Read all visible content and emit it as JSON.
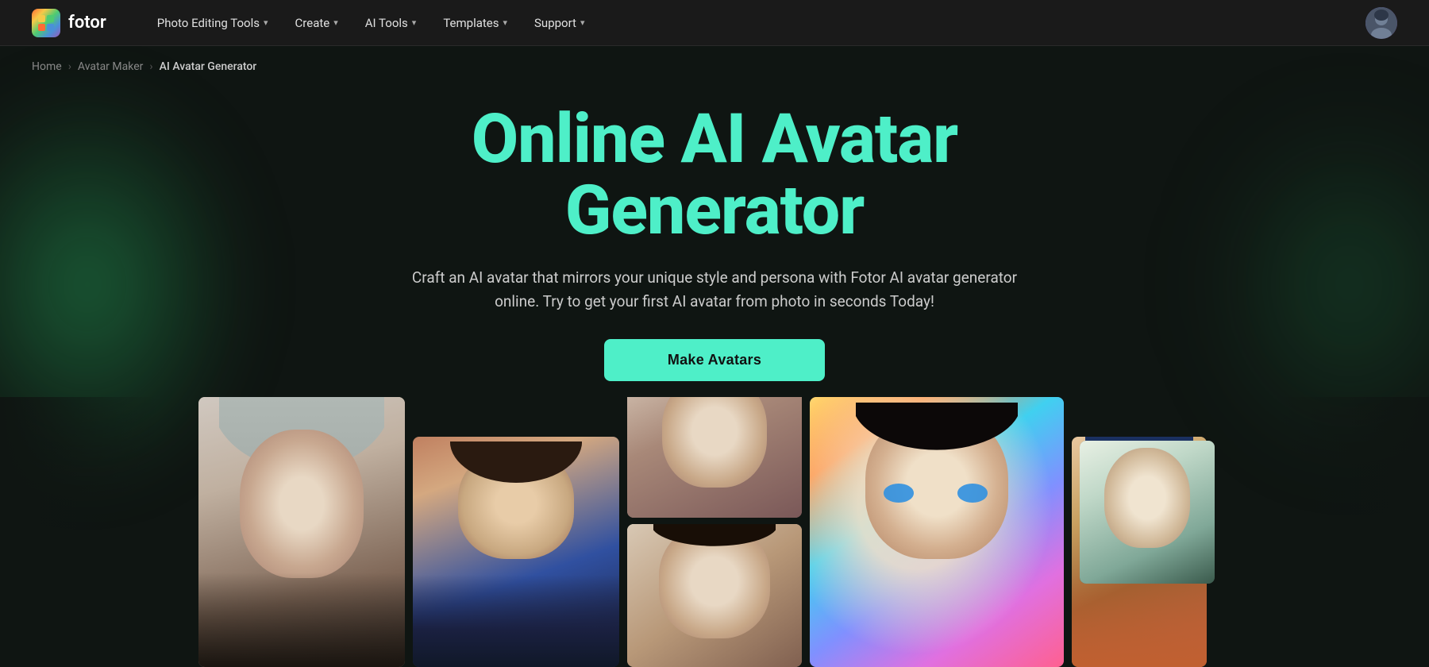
{
  "nav": {
    "logo_text": "fotor",
    "items": [
      {
        "label": "Photo Editing Tools",
        "has_dropdown": true
      },
      {
        "label": "Create",
        "has_dropdown": true
      },
      {
        "label": "AI Tools",
        "has_dropdown": true
      },
      {
        "label": "Templates",
        "has_dropdown": true
      },
      {
        "label": "Support",
        "has_dropdown": true
      }
    ]
  },
  "breadcrumb": {
    "items": [
      {
        "label": "Home",
        "active": false
      },
      {
        "label": "Avatar Maker",
        "active": false
      },
      {
        "label": "AI Avatar Generator",
        "active": true
      }
    ]
  },
  "hero": {
    "title_line1": "Online AI Avatar",
    "title_line2": "Generator",
    "subtitle": "Craft an AI avatar that mirrors your unique style and persona with Fotor AI avatar generator online. Try to get your first AI avatar from photo in seconds Today!",
    "cta_label": "Make Avatars"
  }
}
